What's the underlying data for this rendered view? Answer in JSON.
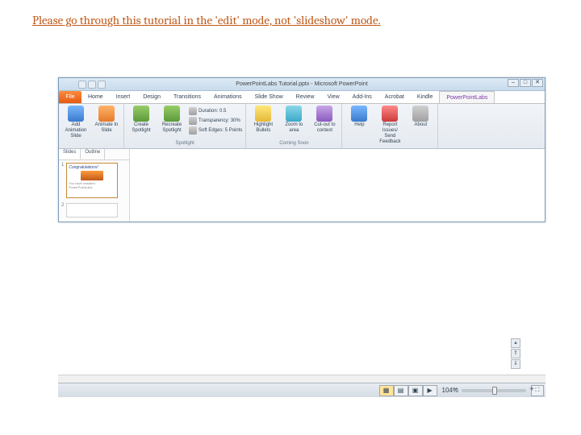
{
  "instruction": "Please go through this tutorial in the 'edit' mode, not 'slideshow' mode.",
  "titlebar": {
    "title": "PowerPointLabs Tutorial.pptx - Microsoft PowerPoint"
  },
  "tabs": {
    "file": "File",
    "items": [
      "Home",
      "Insert",
      "Design",
      "Transitions",
      "Animations",
      "Slide Show",
      "Review",
      "View",
      "Add-Ins",
      "Acrobat",
      "Kindle",
      "PowerPointLabs"
    ],
    "active": 11
  },
  "ribbon": {
    "groups": [
      {
        "label": "",
        "big": [
          {
            "name": "add-animation-slide",
            "text": "Add Animation Slide",
            "ic": "blue"
          },
          {
            "name": "animate-in-slide",
            "text": "Animate In Slide",
            "ic": "orange"
          }
        ]
      },
      {
        "label": "Spotlight",
        "small": [
          {
            "name": "duration",
            "text": "Duration: 0.5"
          },
          {
            "name": "transparency",
            "text": "Transparency: 30%"
          },
          {
            "name": "soft-edges",
            "text": "Soft Edges: 5 Points"
          }
        ],
        "big": [
          {
            "name": "create-spotlight",
            "text": "Create Spotlight",
            "ic": "green"
          },
          {
            "name": "recreate-spotlight",
            "text": "Recreate Spotlight",
            "ic": "green"
          }
        ]
      },
      {
        "label": "Coming Soon",
        "big": [
          {
            "name": "highlight-bullets",
            "text": "Highlight Bullets",
            "ic": "yellow"
          },
          {
            "name": "zoom-to-area",
            "text": "Zoom to area",
            "ic": "cyan"
          },
          {
            "name": "cut-out",
            "text": "Cut-out to context",
            "ic": "purple"
          }
        ]
      },
      {
        "label": "",
        "big": [
          {
            "name": "help",
            "text": "Help",
            "ic": "blue"
          },
          {
            "name": "report-issues",
            "text": "Report Issues/ Send Feedback",
            "ic": "red"
          },
          {
            "name": "about",
            "text": "About",
            "ic": "gray"
          }
        ]
      }
    ]
  },
  "slidespane": {
    "tabs": [
      "Slides",
      "Outline"
    ],
    "thumb1": {
      "num": "1",
      "title": "Congratulations!",
      "sub": "You have installed PowerPointLabs"
    },
    "thumb2": {
      "num": "2"
    }
  },
  "statusbar": {
    "views": [
      "▦",
      "▤",
      "▣",
      "▶"
    ],
    "zoom": "104%"
  }
}
